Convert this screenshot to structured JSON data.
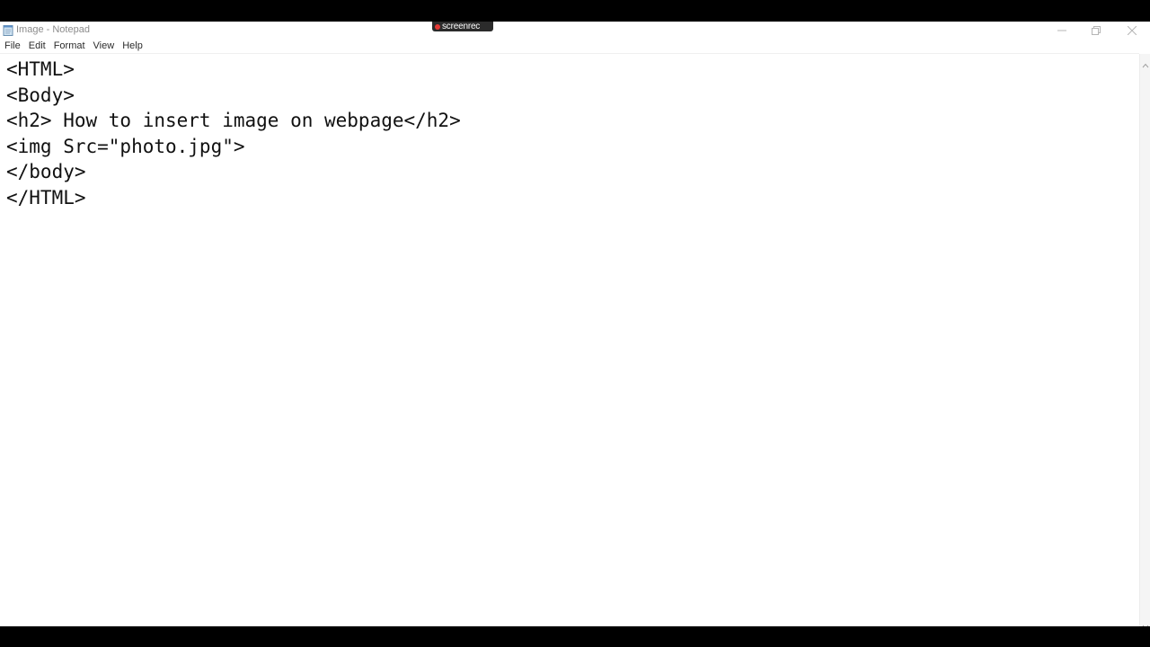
{
  "window": {
    "title": "Image - Notepad",
    "recorder_badge": "screenrec"
  },
  "menu": {
    "items": [
      "File",
      "Edit",
      "Format",
      "View",
      "Help"
    ]
  },
  "editor": {
    "lines": [
      "<HTML>",
      "<Body>",
      "<h2> How to insert image on webpage</h2>",
      "<img Src=\"photo.jpg\">",
      "</body>",
      "</HTML>"
    ]
  },
  "icons": {
    "app": "notepad-icon",
    "minimize": "minimize-icon",
    "maximize": "restore-icon",
    "close": "close-icon"
  },
  "colors": {
    "background": "#ffffff",
    "letterbox": "#000000",
    "title_text": "#8c8c8c",
    "recorder_dot": "#e53935"
  }
}
